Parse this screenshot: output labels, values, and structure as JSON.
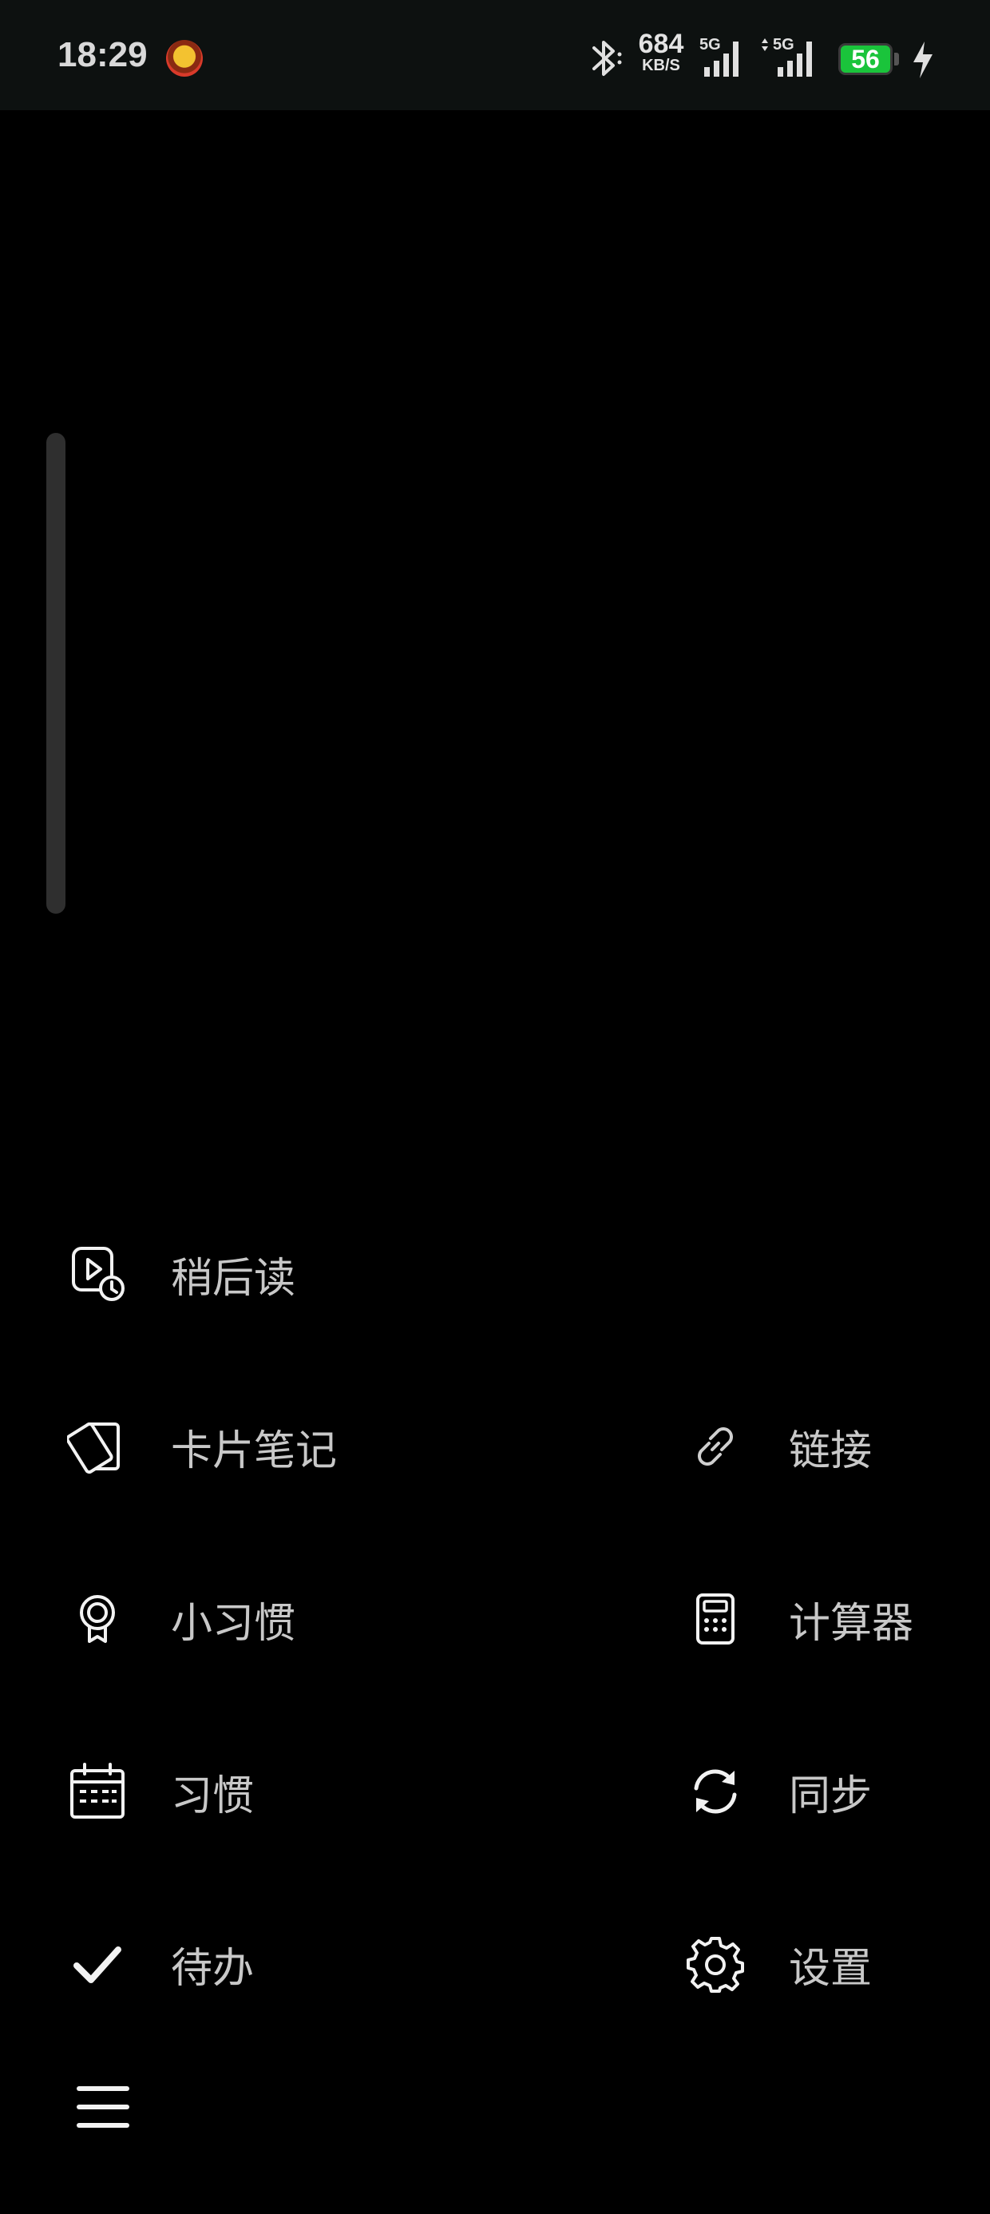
{
  "status_bar": {
    "time": "18:29",
    "network_speed_value": "684",
    "network_speed_unit": "KB/S",
    "signal_1_label": "5G",
    "signal_2_label": "5G",
    "battery_level": "56",
    "colors": {
      "background": "#0d1110",
      "battery": "#1ac43b"
    },
    "icons": [
      "app-notification-icon",
      "bluetooth-icon",
      "signal-icon",
      "signal-icon",
      "battery-icon",
      "charging-icon"
    ]
  },
  "menu": {
    "items": [
      {
        "id": "read-later",
        "label": "稍后读",
        "icon": "read-later-icon"
      },
      {
        "id": "card-notes",
        "label": "卡片笔记",
        "icon": "cards-icon"
      },
      {
        "id": "links",
        "label": "链接",
        "icon": "link-icon"
      },
      {
        "id": "mini-habit",
        "label": "小习惯",
        "icon": "medal-icon"
      },
      {
        "id": "calculator",
        "label": "计算器",
        "icon": "calculator-icon"
      },
      {
        "id": "habit",
        "label": "习惯",
        "icon": "calendar-icon"
      },
      {
        "id": "sync",
        "label": "同步",
        "icon": "sync-icon"
      },
      {
        "id": "todo",
        "label": "待办",
        "icon": "check-icon"
      },
      {
        "id": "settings",
        "label": "设置",
        "icon": "gear-icon"
      }
    ]
  },
  "bottom_bar": {
    "menu_icon": "hamburger-menu-icon"
  },
  "theme": {
    "background": "#000000",
    "text": "#c8c8c8",
    "icon": "#f2f2f2",
    "scroll_indicator": "#2f2f2f"
  }
}
